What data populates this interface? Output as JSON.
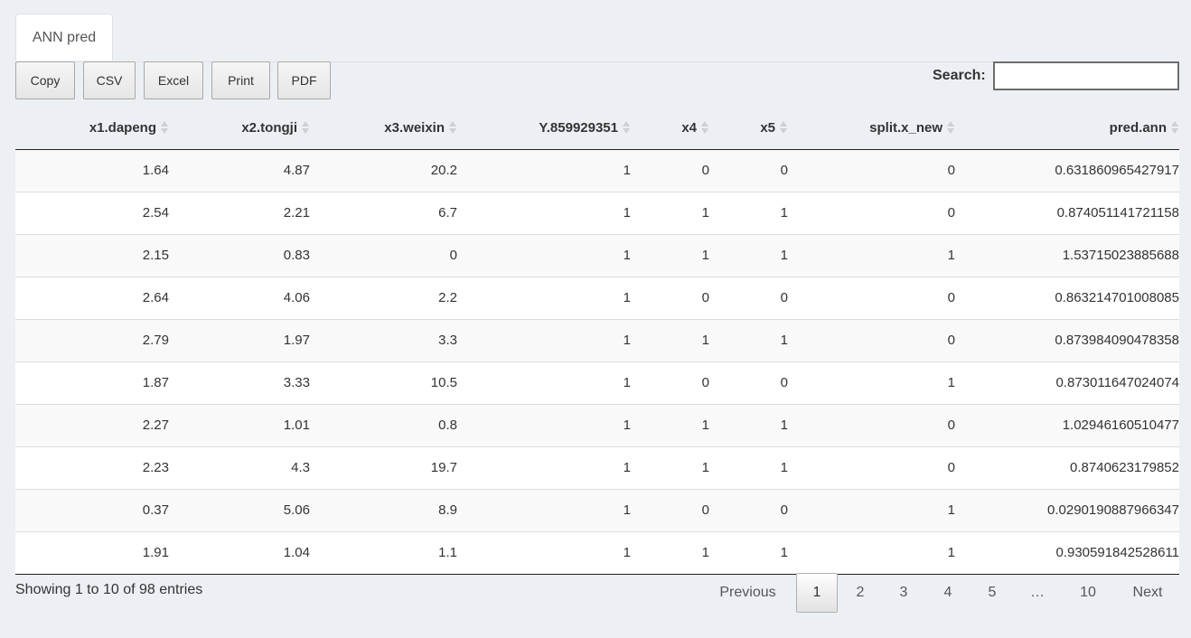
{
  "tabs": [
    {
      "label": "ANN pred"
    }
  ],
  "buttons": {
    "copy": "Copy",
    "csv": "CSV",
    "excel": "Excel",
    "print": "Print",
    "pdf": "PDF"
  },
  "search": {
    "label": "Search:",
    "value": ""
  },
  "table": {
    "columns": [
      "x1.dapeng",
      "x2.tongji",
      "x3.weixin",
      "Y.859929351",
      "x4",
      "x5",
      "split.x_new",
      "pred.ann"
    ],
    "rows": [
      [
        "1.64",
        "4.87",
        "20.2",
        "1",
        "0",
        "0",
        "0",
        "0.631860965427917"
      ],
      [
        "2.54",
        "2.21",
        "6.7",
        "1",
        "1",
        "1",
        "0",
        "0.874051141721158"
      ],
      [
        "2.15",
        "0.83",
        "0",
        "1",
        "1",
        "1",
        "1",
        "1.53715023885688"
      ],
      [
        "2.64",
        "4.06",
        "2.2",
        "1",
        "0",
        "0",
        "0",
        "0.863214701008085"
      ],
      [
        "2.79",
        "1.97",
        "3.3",
        "1",
        "1",
        "1",
        "0",
        "0.873984090478358"
      ],
      [
        "1.87",
        "3.33",
        "10.5",
        "1",
        "0",
        "0",
        "1",
        "0.873011647024074"
      ],
      [
        "2.27",
        "1.01",
        "0.8",
        "1",
        "1",
        "1",
        "0",
        "1.02946160510477"
      ],
      [
        "2.23",
        "4.3",
        "19.7",
        "1",
        "1",
        "1",
        "0",
        "0.8740623179852"
      ],
      [
        "0.37",
        "5.06",
        "8.9",
        "1",
        "0",
        "0",
        "1",
        "0.0290190887966347"
      ],
      [
        "1.91",
        "1.04",
        "1.1",
        "1",
        "1",
        "1",
        "1",
        "0.930591842528611"
      ]
    ]
  },
  "info": "Showing 1 to 10 of 98 entries",
  "pagination": {
    "previous": "Previous",
    "pages": [
      "1",
      "2",
      "3",
      "4",
      "5",
      "…",
      "10"
    ],
    "current": "1",
    "next": "Next"
  }
}
